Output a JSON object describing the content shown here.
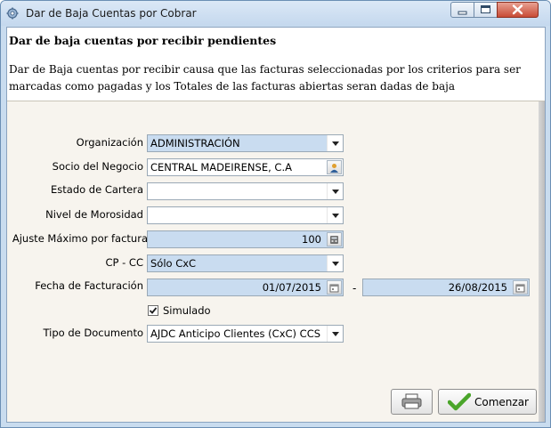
{
  "window": {
    "title": "Dar de Baja Cuentas por Cobrar"
  },
  "header": {
    "title": "Dar de baja cuentas por recibir pendientes",
    "description": "Dar de Baja cuentas por recibir causa que las facturas seleccionadas por los criterios para ser marcadas como pagadas y los Totales de las facturas abiertas seran dadas de baja"
  },
  "form": {
    "organizacion": {
      "label": "Organización",
      "value": "ADMINISTRACIÓN"
    },
    "socio": {
      "label": "Socio del Negocio",
      "value": "CENTRAL MADEIRENSE, C.A"
    },
    "estado": {
      "label": "Estado de Cartera",
      "value": ""
    },
    "nivel": {
      "label": "Nivel de Morosidad",
      "value": ""
    },
    "ajuste": {
      "label": "Ajuste Máximo por factura",
      "value": "100"
    },
    "cpcc": {
      "label": "CP - CC",
      "value": "Sólo CxC"
    },
    "fecha": {
      "label": "Fecha de Facturación",
      "from": "01/07/2015",
      "separator": "-",
      "to": "26/08/2015"
    },
    "simulado": {
      "label": "Simulado",
      "checked": true
    },
    "tipo": {
      "label": "Tipo de Documento",
      "value": "AJDC Anticipo Clientes (CxC) CCS"
    }
  },
  "buttons": {
    "start_label": "Comenzar"
  },
  "icons": {
    "app": "gear-icon",
    "minimize": "minimize-icon",
    "maximize": "maximize-icon",
    "close": "close-icon",
    "partner": "user-icon",
    "calculator": "calculator-icon",
    "calendar": "calendar-icon",
    "print": "printer-icon",
    "checkmark": "checkmark-icon"
  },
  "colors": {
    "title_bg": "#c4d8ee",
    "field_blue": "#c9dcf0",
    "panel_bg": "#f7f4ee",
    "close_red": "#c84b35",
    "check_green": "#4aa52a"
  }
}
